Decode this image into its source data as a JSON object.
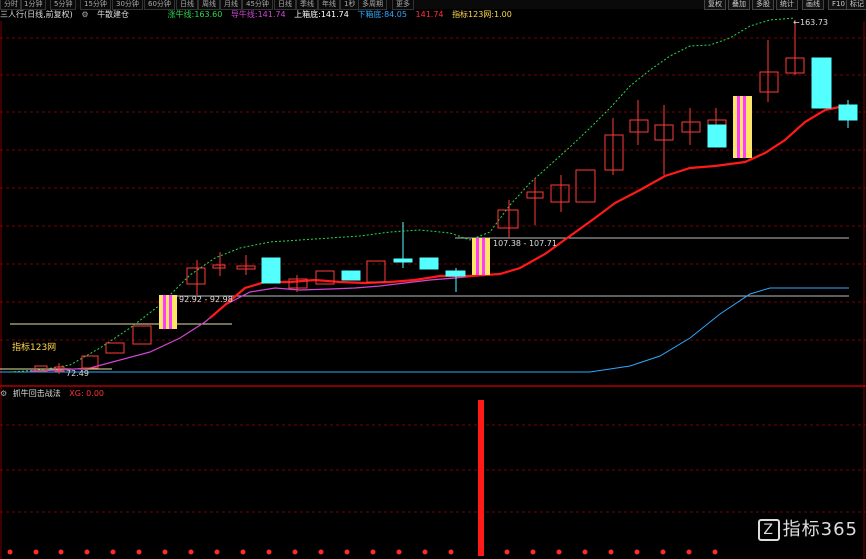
{
  "toolbar": {
    "tabs": [
      "分时",
      "1分钟",
      "5分钟",
      "15分钟",
      "30分钟",
      "60分钟",
      "日线",
      "周线",
      "月线",
      "45分钟",
      "日线",
      "季线",
      "年线",
      "1秒",
      "多周期",
      "更多"
    ],
    "right": [
      "复权",
      "叠加",
      "多股",
      "统计",
      "画线",
      "F10",
      "标记",
      "-"
    ]
  },
  "info": {
    "title": "三人行(日线,前复权)",
    "indicator": "牛散建仓",
    "items": [
      {
        "label": "涨牛线",
        "value": "163.60",
        "color": "#29d94a"
      },
      {
        "label": "导牛线",
        "value": "141.74",
        "color": "#d046d0"
      },
      {
        "label": "上箱底",
        "value": "141.74",
        "color": "#ffffff"
      },
      {
        "label": "下箱底",
        "value": "84.05",
        "color": "#2fa8ff"
      },
      {
        "label": "",
        "value": "141.74",
        "color": "#ff3333"
      },
      {
        "label": "指标123网",
        "value": "1.00",
        "color": "#ffd84a"
      }
    ]
  },
  "annotations": {
    "high": "163.73",
    "low": "72.49",
    "box1": "92.92 - 92.98",
    "box2": "107.38 - 107.71",
    "watermark_left": "指标123网"
  },
  "sub": {
    "title": "抓牛回击战法",
    "value": "XG: 0.00"
  },
  "logo": {
    "badge": "Z",
    "text": "指标365"
  },
  "colors": {
    "up": "#ff3a3a",
    "down": "#54ffff",
    "bg": "#000000",
    "grid": "#6a0000"
  }
}
